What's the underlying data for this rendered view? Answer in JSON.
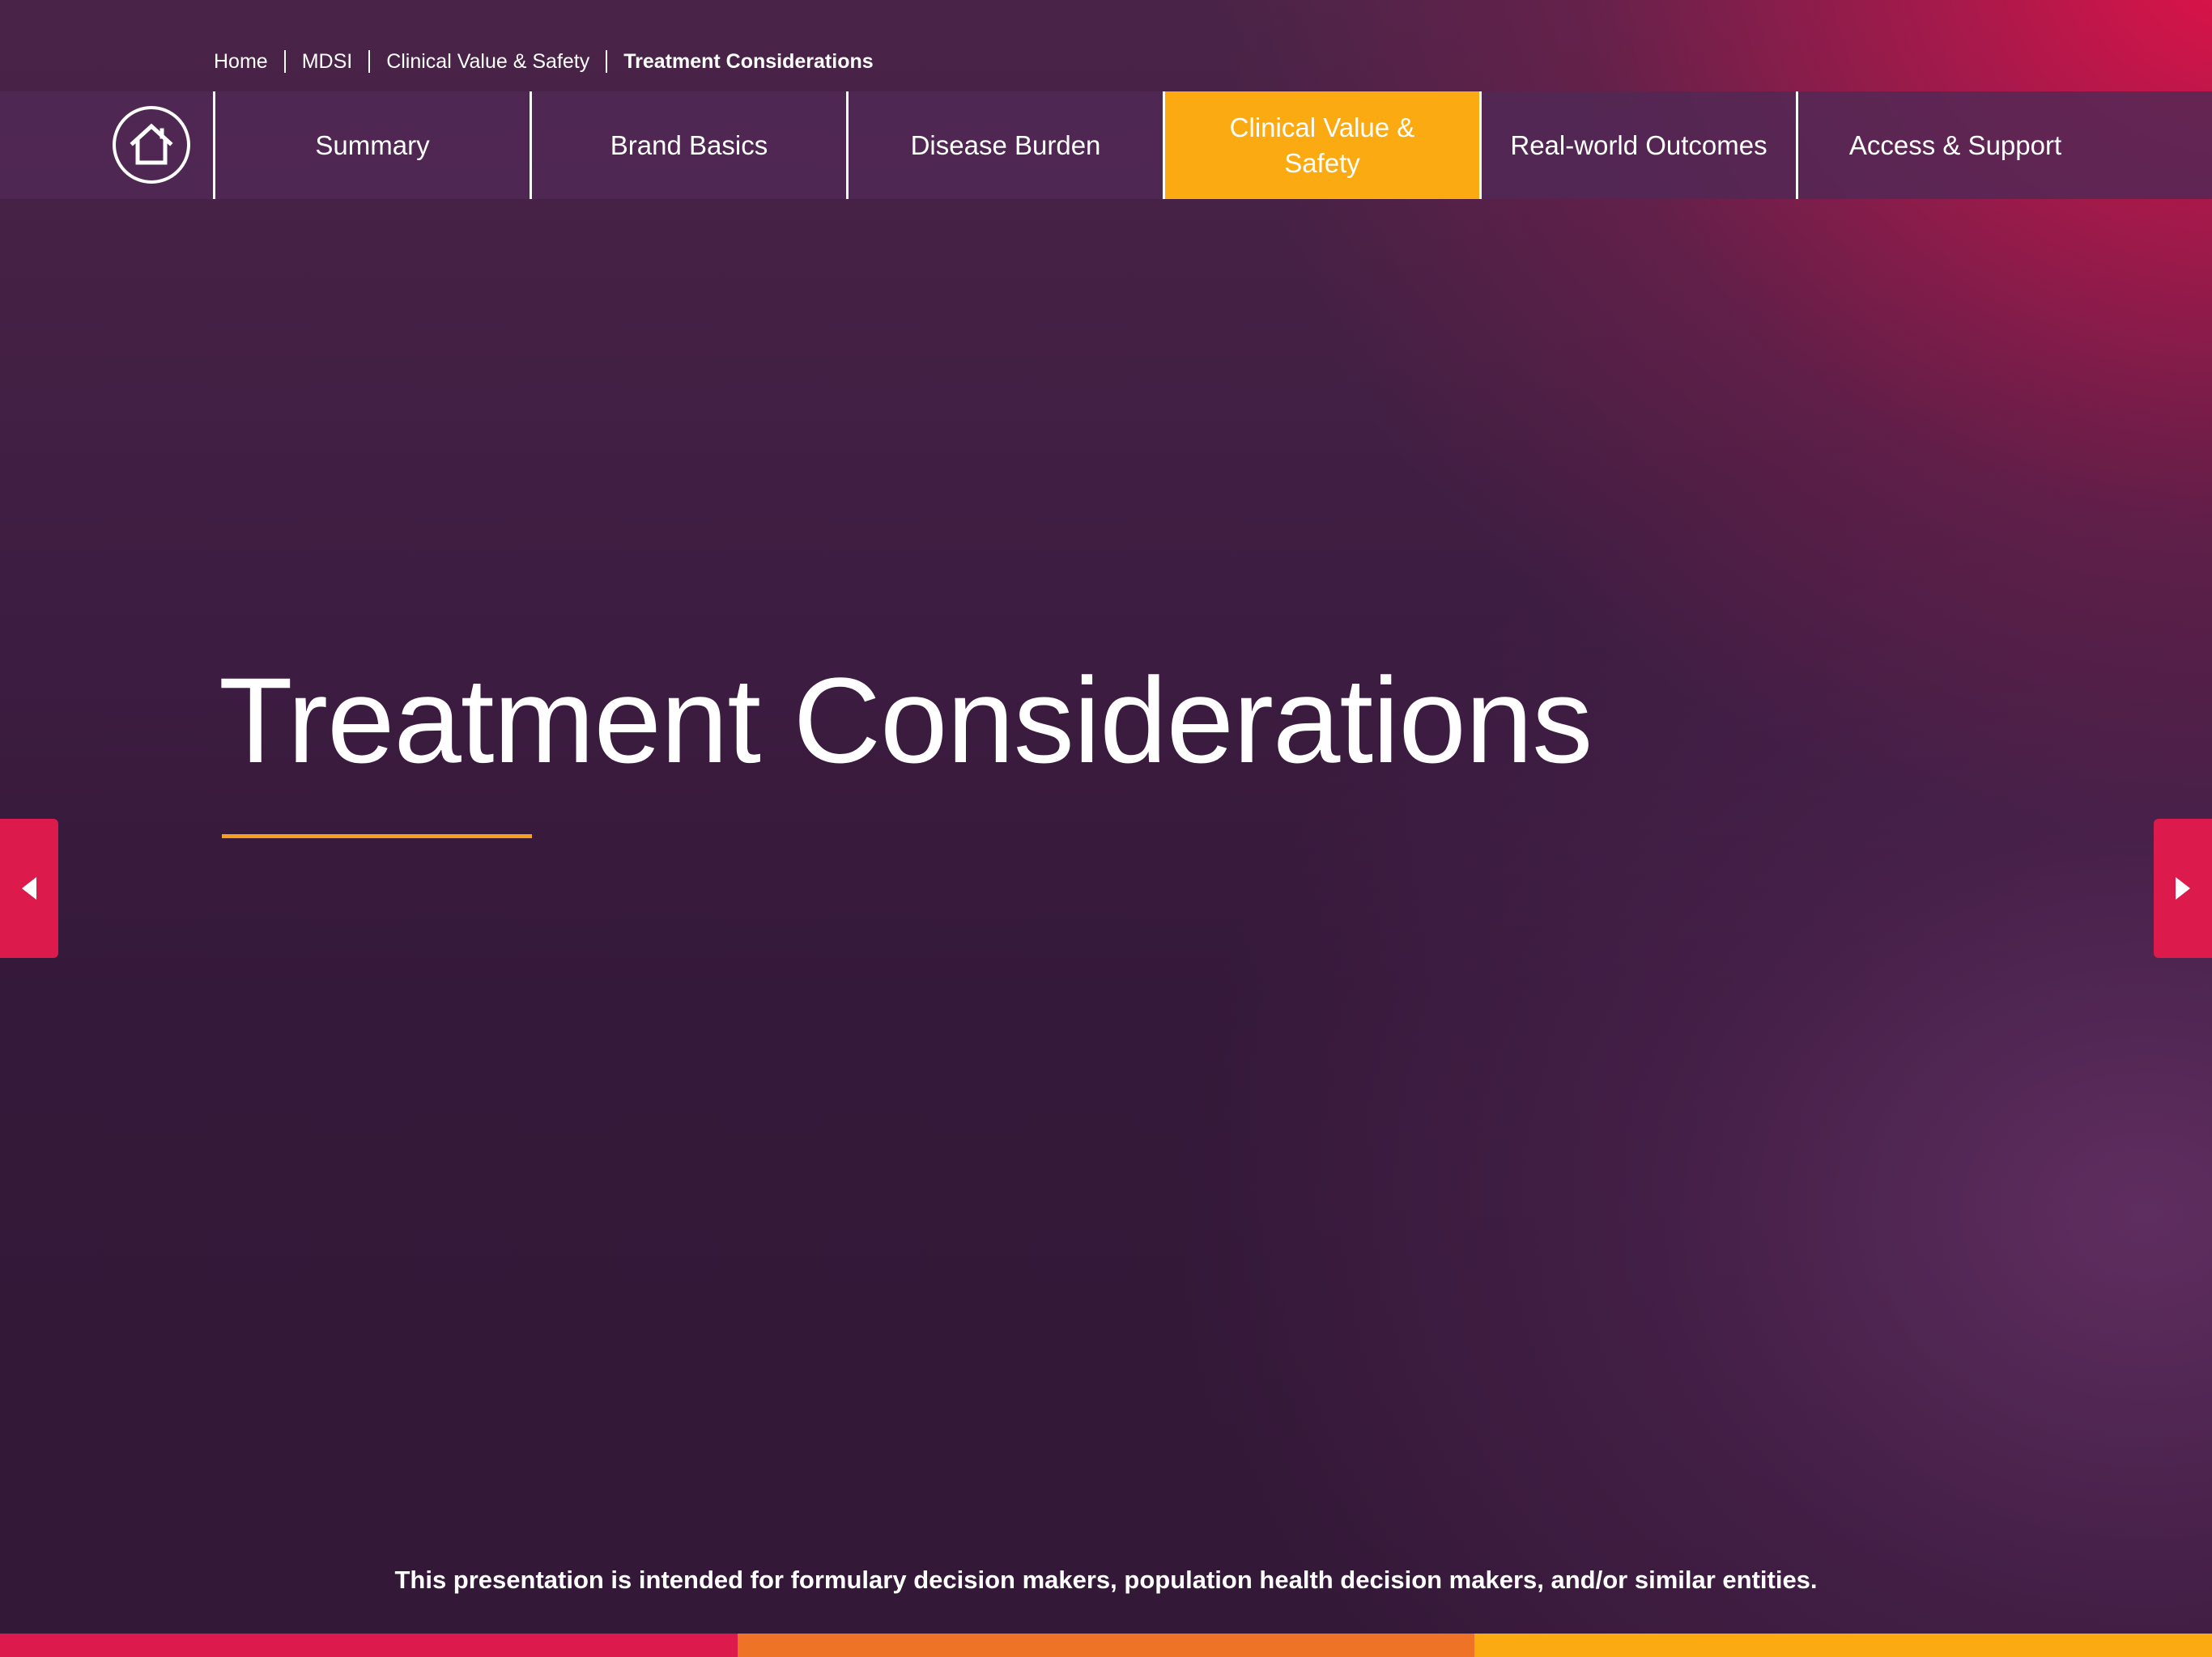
{
  "breadcrumb": {
    "items": [
      "Home",
      "MDSI",
      "Clinical Value & Safety"
    ],
    "current": "Treatment Considerations"
  },
  "nav": {
    "home_icon": "home-icon",
    "items": [
      {
        "label": "Summary"
      },
      {
        "label": "Brand Basics"
      },
      {
        "label": "Disease Burden"
      },
      {
        "label": "Clinical Value & Safety",
        "active": true
      },
      {
        "label": "Real-world Outcomes"
      },
      {
        "label": "Access & Support"
      }
    ]
  },
  "main": {
    "title": "Treatment Considerations"
  },
  "arrows": {
    "prev_icon": "caret-left-icon",
    "next_icon": "caret-right-icon"
  },
  "footer": {
    "disclaimer": "This presentation is intended for formulary decision makers, population health decision makers, and/or similar entities."
  },
  "colors": {
    "accent_orange": "#fcaa12",
    "accent_pink": "#dc1a4c",
    "stripe_colors": [
      "#dc1a4c",
      "#ee7326",
      "#fcaa12"
    ]
  }
}
